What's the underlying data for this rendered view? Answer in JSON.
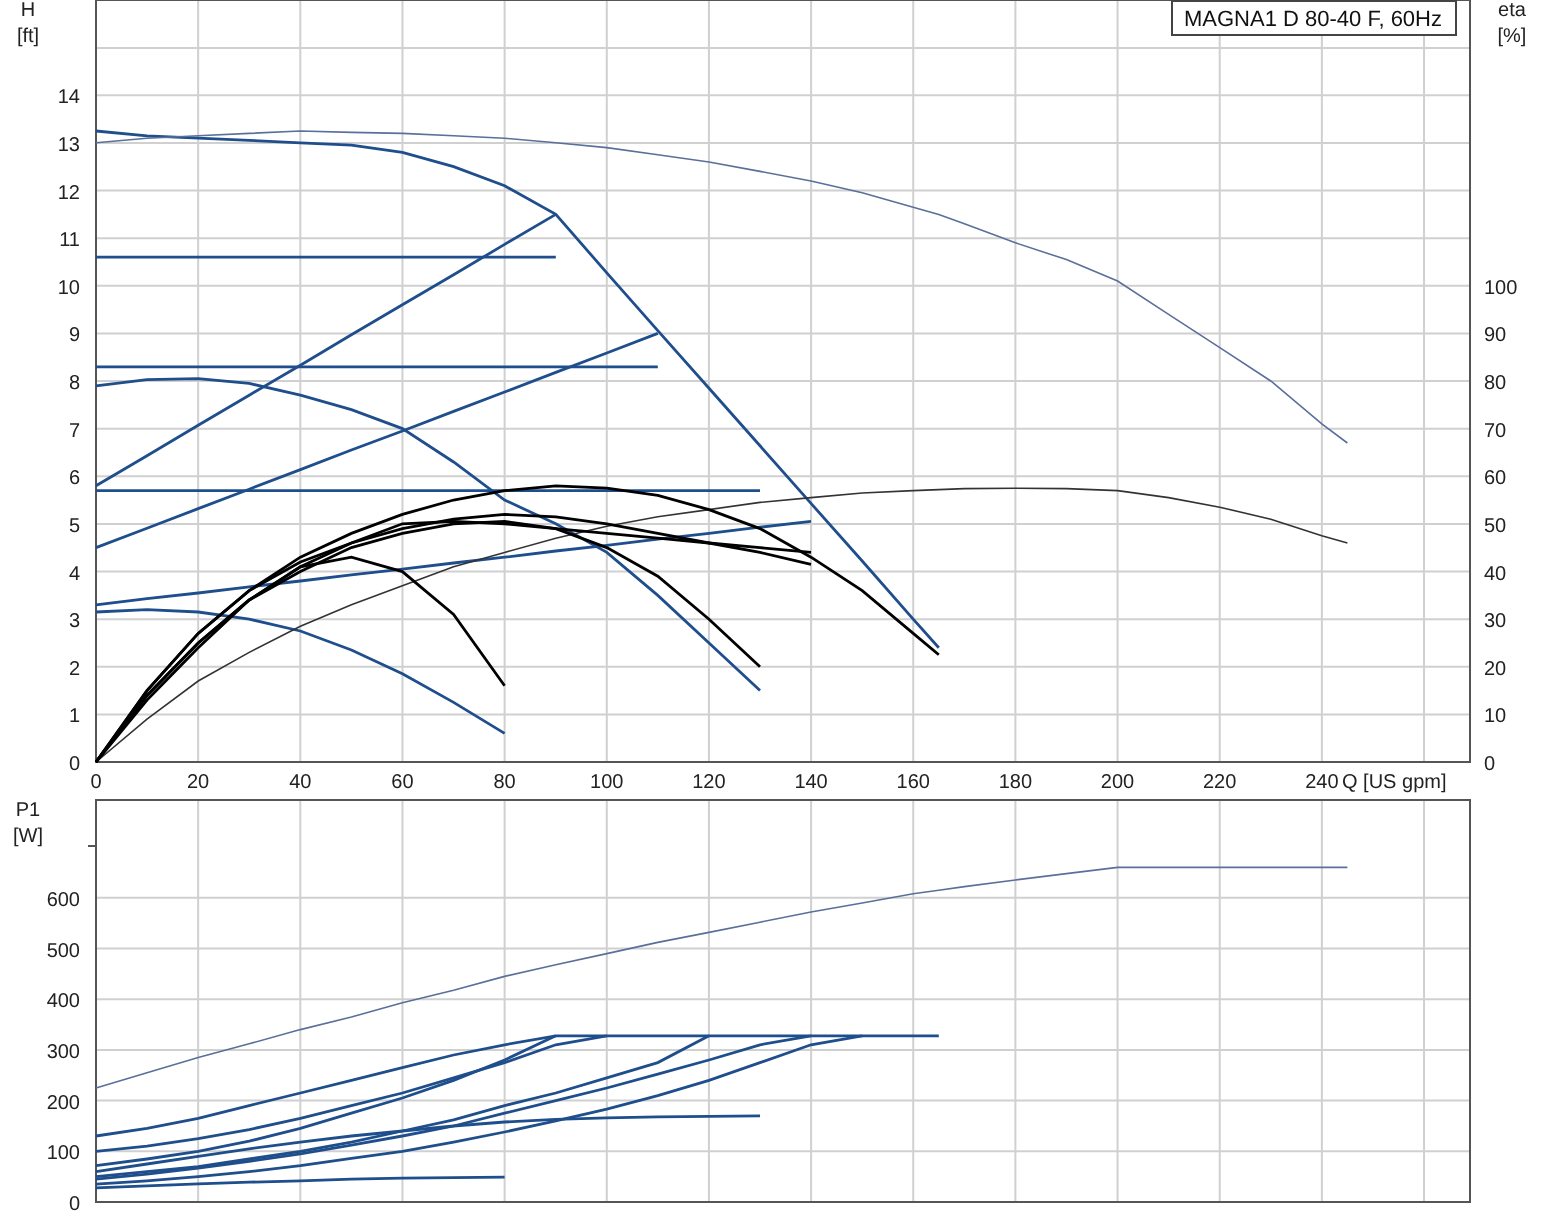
{
  "charts": [
    {
      "chart_data": {
        "type": "line",
        "grid": true,
        "title": "MAGNA1 D 80-40 F, 60Hz",
        "xlabel": "Q [US gpm]",
        "ylabel": "H [ft]",
        "y2label": "eta [%]",
        "x": [
          0,
          10,
          20,
          30,
          40,
          50,
          60,
          70,
          80,
          90,
          100,
          110,
          120,
          130,
          140,
          150,
          160,
          165,
          170,
          180,
          190,
          200,
          210,
          220,
          230,
          240,
          245
        ],
        "xlim": [
          0,
          269
        ],
        "ylim": [
          0,
          16
        ],
        "y2lim": [
          0,
          160
        ],
        "xticks": [
          0,
          20,
          40,
          60,
          80,
          100,
          120,
          140,
          160,
          180,
          200,
          220,
          240
        ],
        "yticks": [
          0,
          1,
          2,
          3,
          4,
          5,
          6,
          7,
          8,
          9,
          10,
          11,
          12,
          13,
          14
        ],
        "y2ticks": [
          0,
          10,
          20,
          30,
          40,
          50,
          60,
          70,
          80,
          90,
          100
        ],
        "series": [
          {
            "color": "#1f4e8c",
            "values": [
              13.25,
              13.15,
              13.1,
              13.05,
              13.0,
              12.95,
              12.8,
              12.5,
              12.1,
              11.5,
              10.27,
              9.06,
              7.85,
              6.64,
              5.43,
              4.22,
              3.0,
              2.4,
              null,
              null,
              null,
              null,
              null,
              null,
              null,
              null,
              null
            ]
          },
          {
            "color": "#5a6f9a",
            "values": [
              13.0,
              13.1,
              13.15,
              13.2,
              13.25,
              13.22,
              13.2,
              13.15,
              13.1,
              13.0,
              12.9,
              12.75,
              12.6,
              12.4,
              12.2,
              11.95,
              11.65,
              11.5,
              11.3,
              10.9,
              10.55,
              10.1,
              9.4,
              8.7,
              8.0,
              7.1,
              6.7
            ]
          },
          {
            "color": "#1f4e8c",
            "values": [
              10.6,
              10.6,
              10.6,
              10.6,
              10.6,
              10.6,
              10.6,
              10.6,
              10.6,
              10.6,
              null,
              null,
              null,
              null,
              null,
              null,
              null,
              null,
              null,
              null,
              null,
              null,
              null,
              null,
              null,
              null,
              null
            ]
          },
          {
            "color": "#1f4e8c",
            "values": [
              8.3,
              8.3,
              8.3,
              8.3,
              8.3,
              8.3,
              8.3,
              8.3,
              8.3,
              8.3,
              8.3,
              8.3,
              null,
              null,
              null,
              null,
              null,
              null,
              null,
              null,
              null,
              null,
              null,
              null,
              null,
              null,
              null
            ]
          },
          {
            "color": "#1f4e8c",
            "values": [
              5.7,
              5.7,
              5.7,
              5.7,
              5.7,
              5.7,
              5.7,
              5.7,
              5.7,
              5.7,
              5.7,
              5.7,
              5.7,
              5.7,
              null,
              null,
              null,
              null,
              null,
              null,
              null,
              null,
              null,
              null,
              null,
              null,
              null
            ]
          },
          {
            "color": "#1f4e8c",
            "values": [
              5.8,
              6.43,
              7.07,
              7.7,
              8.33,
              8.97,
              9.6,
              10.23,
              10.87,
              11.5,
              null,
              null,
              null,
              null,
              null,
              null,
              null,
              null,
              null,
              null,
              null,
              null,
              null,
              null,
              null,
              null,
              null
            ]
          },
          {
            "color": "#1f4e8c",
            "values": [
              4.5,
              4.91,
              5.32,
              5.73,
              6.14,
              6.55,
              6.95,
              7.36,
              7.77,
              8.18,
              8.59,
              9.0,
              null,
              null,
              null,
              null,
              null,
              null,
              null,
              null,
              null,
              null,
              null,
              null,
              null,
              null,
              null
            ]
          },
          {
            "color": "#1f4e8c",
            "values": [
              3.3,
              3.43,
              3.55,
              3.68,
              3.8,
              3.93,
              4.05,
              4.18,
              4.3,
              4.43,
              4.55,
              4.68,
              4.8,
              4.93,
              5.05,
              null,
              null,
              null,
              null,
              null,
              null,
              null,
              null,
              null,
              null,
              null,
              null
            ]
          },
          {
            "color": "#1f4e8c",
            "values": [
              7.9,
              8.03,
              8.05,
              7.95,
              7.7,
              7.4,
              7.0,
              6.3,
              5.5,
              5.0,
              4.4,
              3.5,
              2.5,
              1.5,
              null,
              null,
              null,
              null,
              null,
              null,
              null,
              null,
              null,
              null,
              null,
              null,
              null
            ]
          },
          {
            "color": "#1f4e8c",
            "values": [
              3.15,
              3.2,
              3.15,
              3.0,
              2.75,
              2.35,
              1.85,
              1.25,
              0.6,
              null,
              null,
              null,
              null,
              null,
              null,
              null,
              null,
              null,
              null,
              null,
              null,
              null,
              null,
              null,
              null,
              null,
              null
            ]
          },
          {
            "color": "#333333",
            "axis": "y2",
            "values": [
              0,
              9,
              17,
              23,
              28.5,
              33,
              37,
              41,
              44,
              47,
              49.5,
              51.5,
              53,
              54.5,
              55.5,
              56.5,
              57,
              57.2,
              57.4,
              57.5,
              57.4,
              57,
              55.5,
              53.5,
              51,
              47.5,
              46
            ]
          },
          {
            "color": "#000000",
            "axis": "y2",
            "values": [
              0,
              15,
              27,
              36,
              43,
              48,
              52,
              55,
              57,
              58,
              57.5,
              56,
              53,
              49,
              43,
              36,
              27,
              22.5,
              null,
              null,
              null,
              null,
              null,
              null,
              null,
              null,
              null
            ]
          },
          {
            "color": "#000000",
            "axis": "y2",
            "values": [
              0,
              15,
              27,
              36,
              42,
              46,
              49,
              51,
              52,
              51.5,
              50,
              48,
              46,
              44,
              41.5,
              null,
              null,
              null,
              null,
              null,
              null,
              null,
              null,
              null,
              null,
              null,
              null
            ]
          },
          {
            "color": "#000000",
            "axis": "y2",
            "values": [
              0,
              14,
              25,
              34,
              40,
              45,
              48,
              50,
              50.5,
              49,
              45,
              39,
              30,
              20,
              null,
              null,
              null,
              null,
              null,
              null,
              null,
              null,
              null,
              null,
              null,
              null,
              null
            ]
          },
          {
            "color": "#000000",
            "axis": "y2",
            "values": [
              0,
              14,
              25,
              34,
              41,
              46,
              50,
              50.5,
              50,
              49,
              48,
              47,
              46,
              45,
              44,
              null,
              null,
              null,
              null,
              null,
              null,
              null,
              null,
              null,
              null,
              null,
              null
            ]
          },
          {
            "color": "#000000",
            "axis": "y2",
            "values": [
              0,
              13,
              24,
              34,
              41,
              43,
              40,
              31,
              16,
              null,
              null,
              null,
              null,
              null,
              null,
              null,
              null,
              null,
              null,
              null,
              null,
              null,
              null,
              null,
              null,
              null,
              null
            ]
          }
        ]
      }
    },
    {
      "chart_data": {
        "type": "line",
        "grid": true,
        "ylabel": "P1 [W]",
        "x": [
          0,
          10,
          20,
          30,
          40,
          50,
          60,
          70,
          80,
          90,
          100,
          110,
          120,
          130,
          140,
          150,
          160,
          165,
          170,
          180,
          190,
          200,
          210,
          220,
          230,
          240,
          245
        ],
        "xlim": [
          0,
          269
        ],
        "ylim": [
          0,
          793
        ],
        "yticks": [
          0,
          100,
          200,
          300,
          400,
          500,
          600
        ],
        "series": [
          {
            "color": "#5a6f9a",
            "values": [
              225,
              255,
              285,
              312,
              340,
              365,
              393,
              418,
              445,
              468,
              490,
              512,
              532,
              552,
              572,
              590,
              608,
              615,
              622,
              635,
              648,
              660,
              660,
              660,
              660,
              660,
              660
            ]
          },
          {
            "color": "#1f4e8c",
            "values": [
              130,
              145,
              165,
              190,
              215,
              240,
              265,
              290,
              310,
              328,
              328,
              328,
              328,
              328,
              328,
              328,
              328,
              328,
              null,
              null,
              null,
              null,
              null,
              null,
              null,
              null,
              null
            ]
          },
          {
            "color": "#1f4e8c",
            "values": [
              100,
              110,
              125,
              143,
              165,
              190,
              215,
              245,
              275,
              310,
              328,
              null,
              null,
              null,
              null,
              null,
              null,
              null,
              null,
              null,
              null,
              null,
              null,
              null,
              null,
              null,
              null
            ]
          },
          {
            "color": "#1f4e8c",
            "values": [
              72,
              85,
              100,
              120,
              145,
              175,
              205,
              240,
              280,
              328,
              null,
              null,
              null,
              null,
              null,
              null,
              null,
              null,
              null,
              null,
              null,
              null,
              null,
              null,
              null,
              null,
              null
            ]
          },
          {
            "color": "#1f4e8c",
            "values": [
              50,
              60,
              70,
              85,
              100,
              118,
              140,
              162,
              190,
              215,
              245,
              275,
              328,
              null,
              null,
              null,
              null,
              null,
              null,
              null,
              null,
              null,
              null,
              null,
              null,
              null,
              null
            ]
          },
          {
            "color": "#1f4e8c",
            "values": [
              45,
              55,
              67,
              80,
              95,
              112,
              130,
              150,
              175,
              200,
              225,
              252,
              280,
              310,
              328,
              null,
              null,
              null,
              null,
              null,
              null,
              null,
              null,
              null,
              null,
              null,
              null
            ]
          },
          {
            "color": "#1f4e8c",
            "values": [
              35,
              42,
              50,
              60,
              72,
              86,
              100,
              118,
              138,
              160,
              183,
              210,
              240,
              275,
              310,
              328,
              null,
              null,
              null,
              null,
              null,
              null,
              null,
              null,
              null,
              null,
              null
            ]
          },
          {
            "color": "#1f4e8c",
            "values": [
              60,
              75,
              90,
              105,
              118,
              130,
              140,
              150,
              158,
              163,
              166,
              168,
              169,
              170,
              null,
              null,
              null,
              null,
              null,
              null,
              null,
              null,
              null,
              null,
              null,
              null,
              null
            ]
          },
          {
            "color": "#1f4e8c",
            "values": [
              28,
              32,
              36,
              39,
              42,
              45,
              47,
              48,
              49,
              null,
              null,
              null,
              null,
              null,
              null,
              null,
              null,
              null,
              null,
              null,
              null,
              null,
              null,
              null,
              null,
              null,
              null
            ]
          }
        ]
      }
    }
  ]
}
